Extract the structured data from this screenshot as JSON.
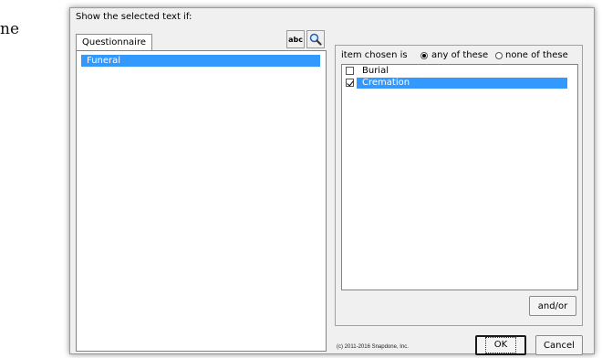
{
  "background_text": "ne",
  "dialog": {
    "heading": "Show the selected text if:",
    "tab_label": "Questionnaire",
    "left_list": {
      "selected_item": "Funeral"
    },
    "abc_label": "abc",
    "condition": {
      "prefix": "item chosen is",
      "any_label": "any of these",
      "none_label": "none of these",
      "selected": "any of these"
    },
    "options": [
      {
        "label": "Burial",
        "checked": false
      },
      {
        "label": "Cremation",
        "checked": true
      }
    ],
    "andor_label": "and/or",
    "ok_label": "OK",
    "cancel_label": "Cancel",
    "copyright": "(c) 2011-2016 Snapdone, Inc."
  },
  "colors": {
    "selection": "#3399ff",
    "dialog_bg": "#f0f0f0"
  }
}
